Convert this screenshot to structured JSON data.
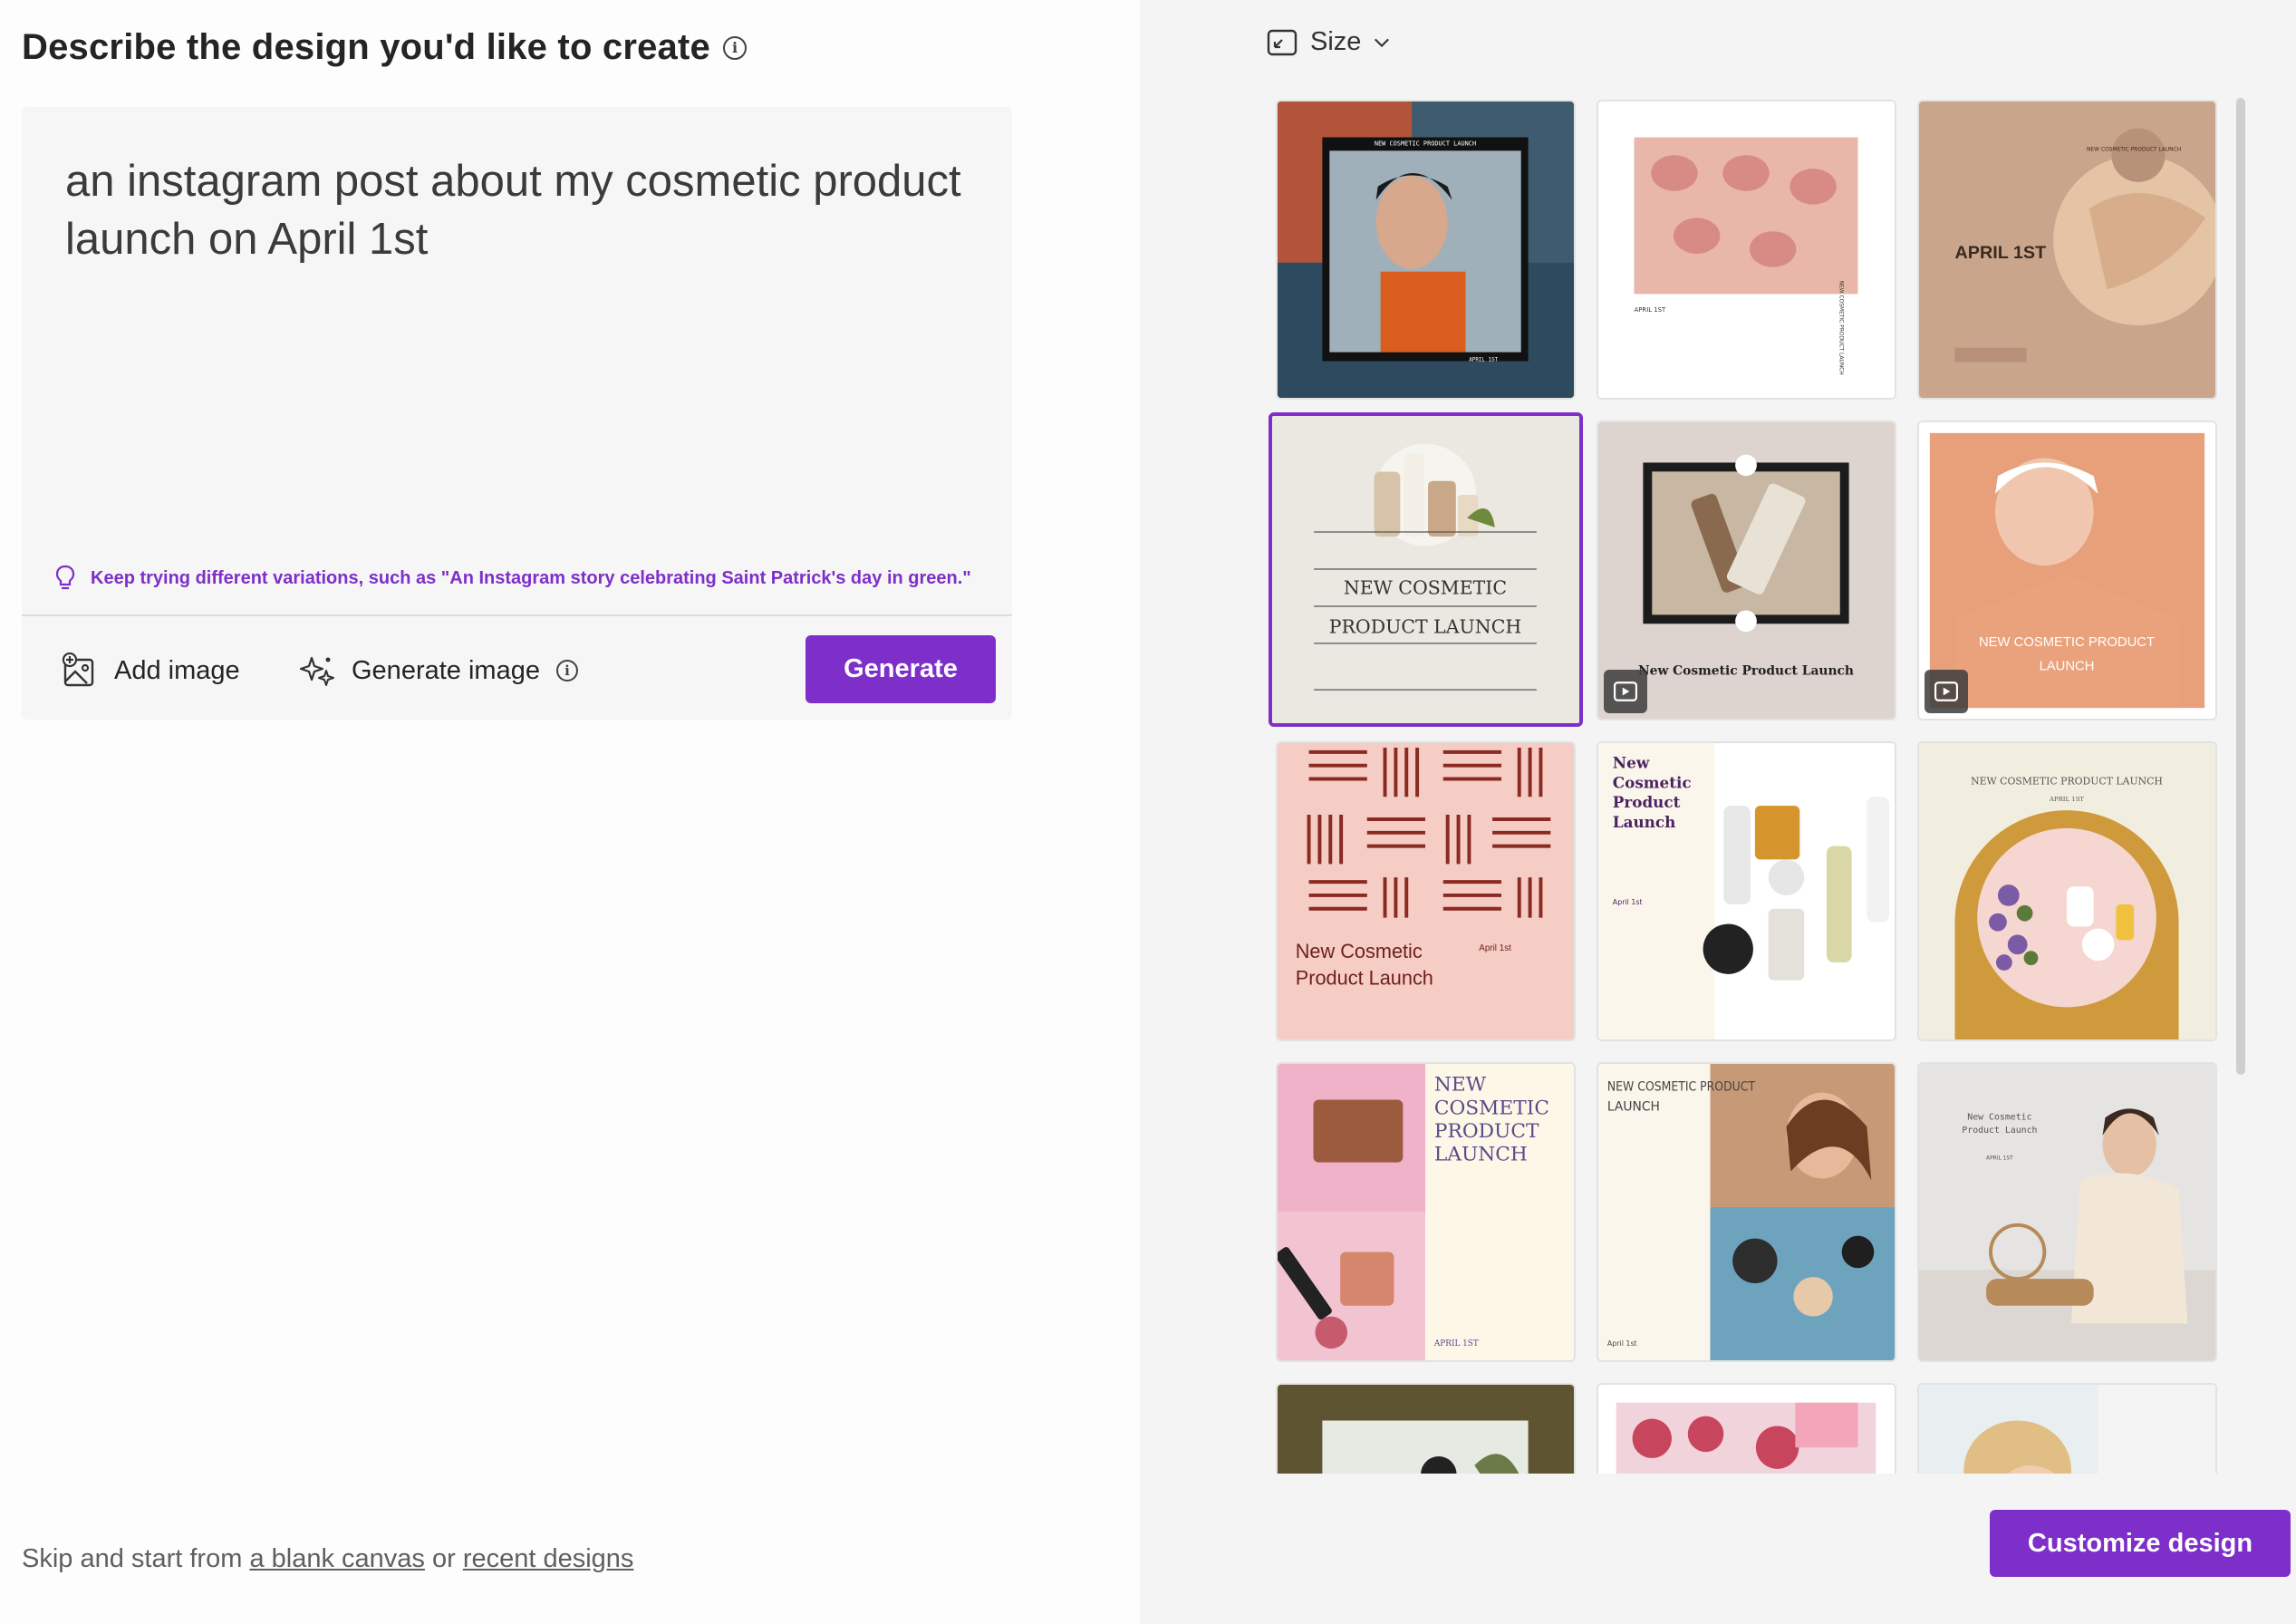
{
  "left": {
    "heading": "Describe the design you'd like to create",
    "prompt": "an instagram post about my cosmetic product launch on April 1st",
    "tip": "Keep trying different variations, such as \"An Instagram story celebrating Saint Patrick's day in green.\"",
    "add_image_label": "Add image",
    "generate_image_label": "Generate image",
    "generate_button": "Generate",
    "skip_prefix": "Skip and start from ",
    "blank_canvas_link": "a blank canvas",
    "skip_or": " or ",
    "recent_designs_link": "recent designs"
  },
  "right": {
    "size_label": "Size",
    "customize_button": "Customize design",
    "templates": [
      {
        "name": "template-1",
        "texts": [
          "NEW COSMETIC PRODUCT LAUNCH",
          "APRIL 1ST"
        ]
      },
      {
        "name": "template-2",
        "texts": [
          "APRIL 1ST",
          "NEW COSMETIC PRODUCT LAUNCH"
        ]
      },
      {
        "name": "template-3",
        "texts": [
          "APRIL 1ST",
          "NEW COSMETIC PRODUCT LAUNCH"
        ]
      },
      {
        "name": "template-4",
        "texts": [
          "NEW COSMETIC",
          "PRODUCT LAUNCH"
        ],
        "selected": true
      },
      {
        "name": "template-5",
        "texts": [
          "New Cosmetic Product Launch"
        ],
        "video": true
      },
      {
        "name": "template-6",
        "texts": [
          "NEW COSMETIC PRODUCT",
          "LAUNCH"
        ],
        "video": true
      },
      {
        "name": "template-7",
        "texts": [
          "New Cosmetic",
          "Product Launch",
          "April 1st"
        ]
      },
      {
        "name": "template-8",
        "texts": [
          "New",
          "Cosmetic",
          "Product",
          "Launch",
          "April 1st"
        ]
      },
      {
        "name": "template-9",
        "texts": [
          "NEW COSMETIC PRODUCT LAUNCH",
          "APRIL 1ST"
        ]
      },
      {
        "name": "template-10",
        "texts": [
          "NEW",
          "COSMETIC",
          "PRODUCT",
          "LAUNCH",
          "APRIL 1ST"
        ]
      },
      {
        "name": "template-11",
        "texts": [
          "NEW COSMETIC PRODUCT",
          "LAUNCH",
          "April 1st"
        ]
      },
      {
        "name": "template-12",
        "texts": [
          "New Cosmetic",
          "Product Launch",
          "APRIL 1ST"
        ]
      }
    ]
  },
  "colors": {
    "accent": "#7e2fc9"
  }
}
